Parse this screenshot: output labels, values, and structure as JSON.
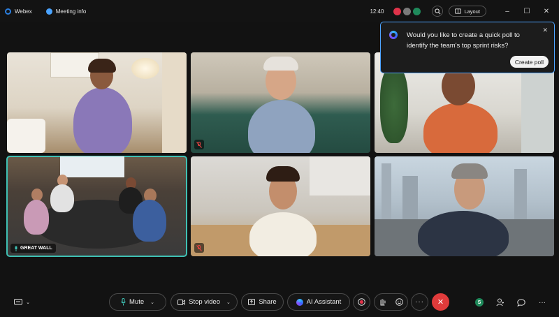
{
  "titlebar": {
    "app_name": "Webex",
    "meeting_info": "Meeting info",
    "time": "12:40",
    "layout_label": "Layout"
  },
  "tiles": [
    {
      "name": "tile-1",
      "muted": false
    },
    {
      "name": "tile-2",
      "muted": true
    },
    {
      "name": "tile-3",
      "muted": false
    },
    {
      "name": "tile-room",
      "label": "GREAT WALL",
      "active": true
    },
    {
      "name": "tile-5",
      "muted": true
    },
    {
      "name": "tile-6",
      "muted": false
    }
  ],
  "poll": {
    "message": "Would you like to create a quick poll to identify the team's top sprint risks?",
    "button_label": "Create poll"
  },
  "controls": {
    "mute_label": "Mute",
    "stop_video_label": "Stop video",
    "share_label": "Share",
    "ai_assistant_label": "AI Assistant"
  },
  "colors": {
    "accent_teal": "#3fc1b4",
    "popup_border": "#4ea4ff",
    "leave_red": "#e03b3b"
  }
}
